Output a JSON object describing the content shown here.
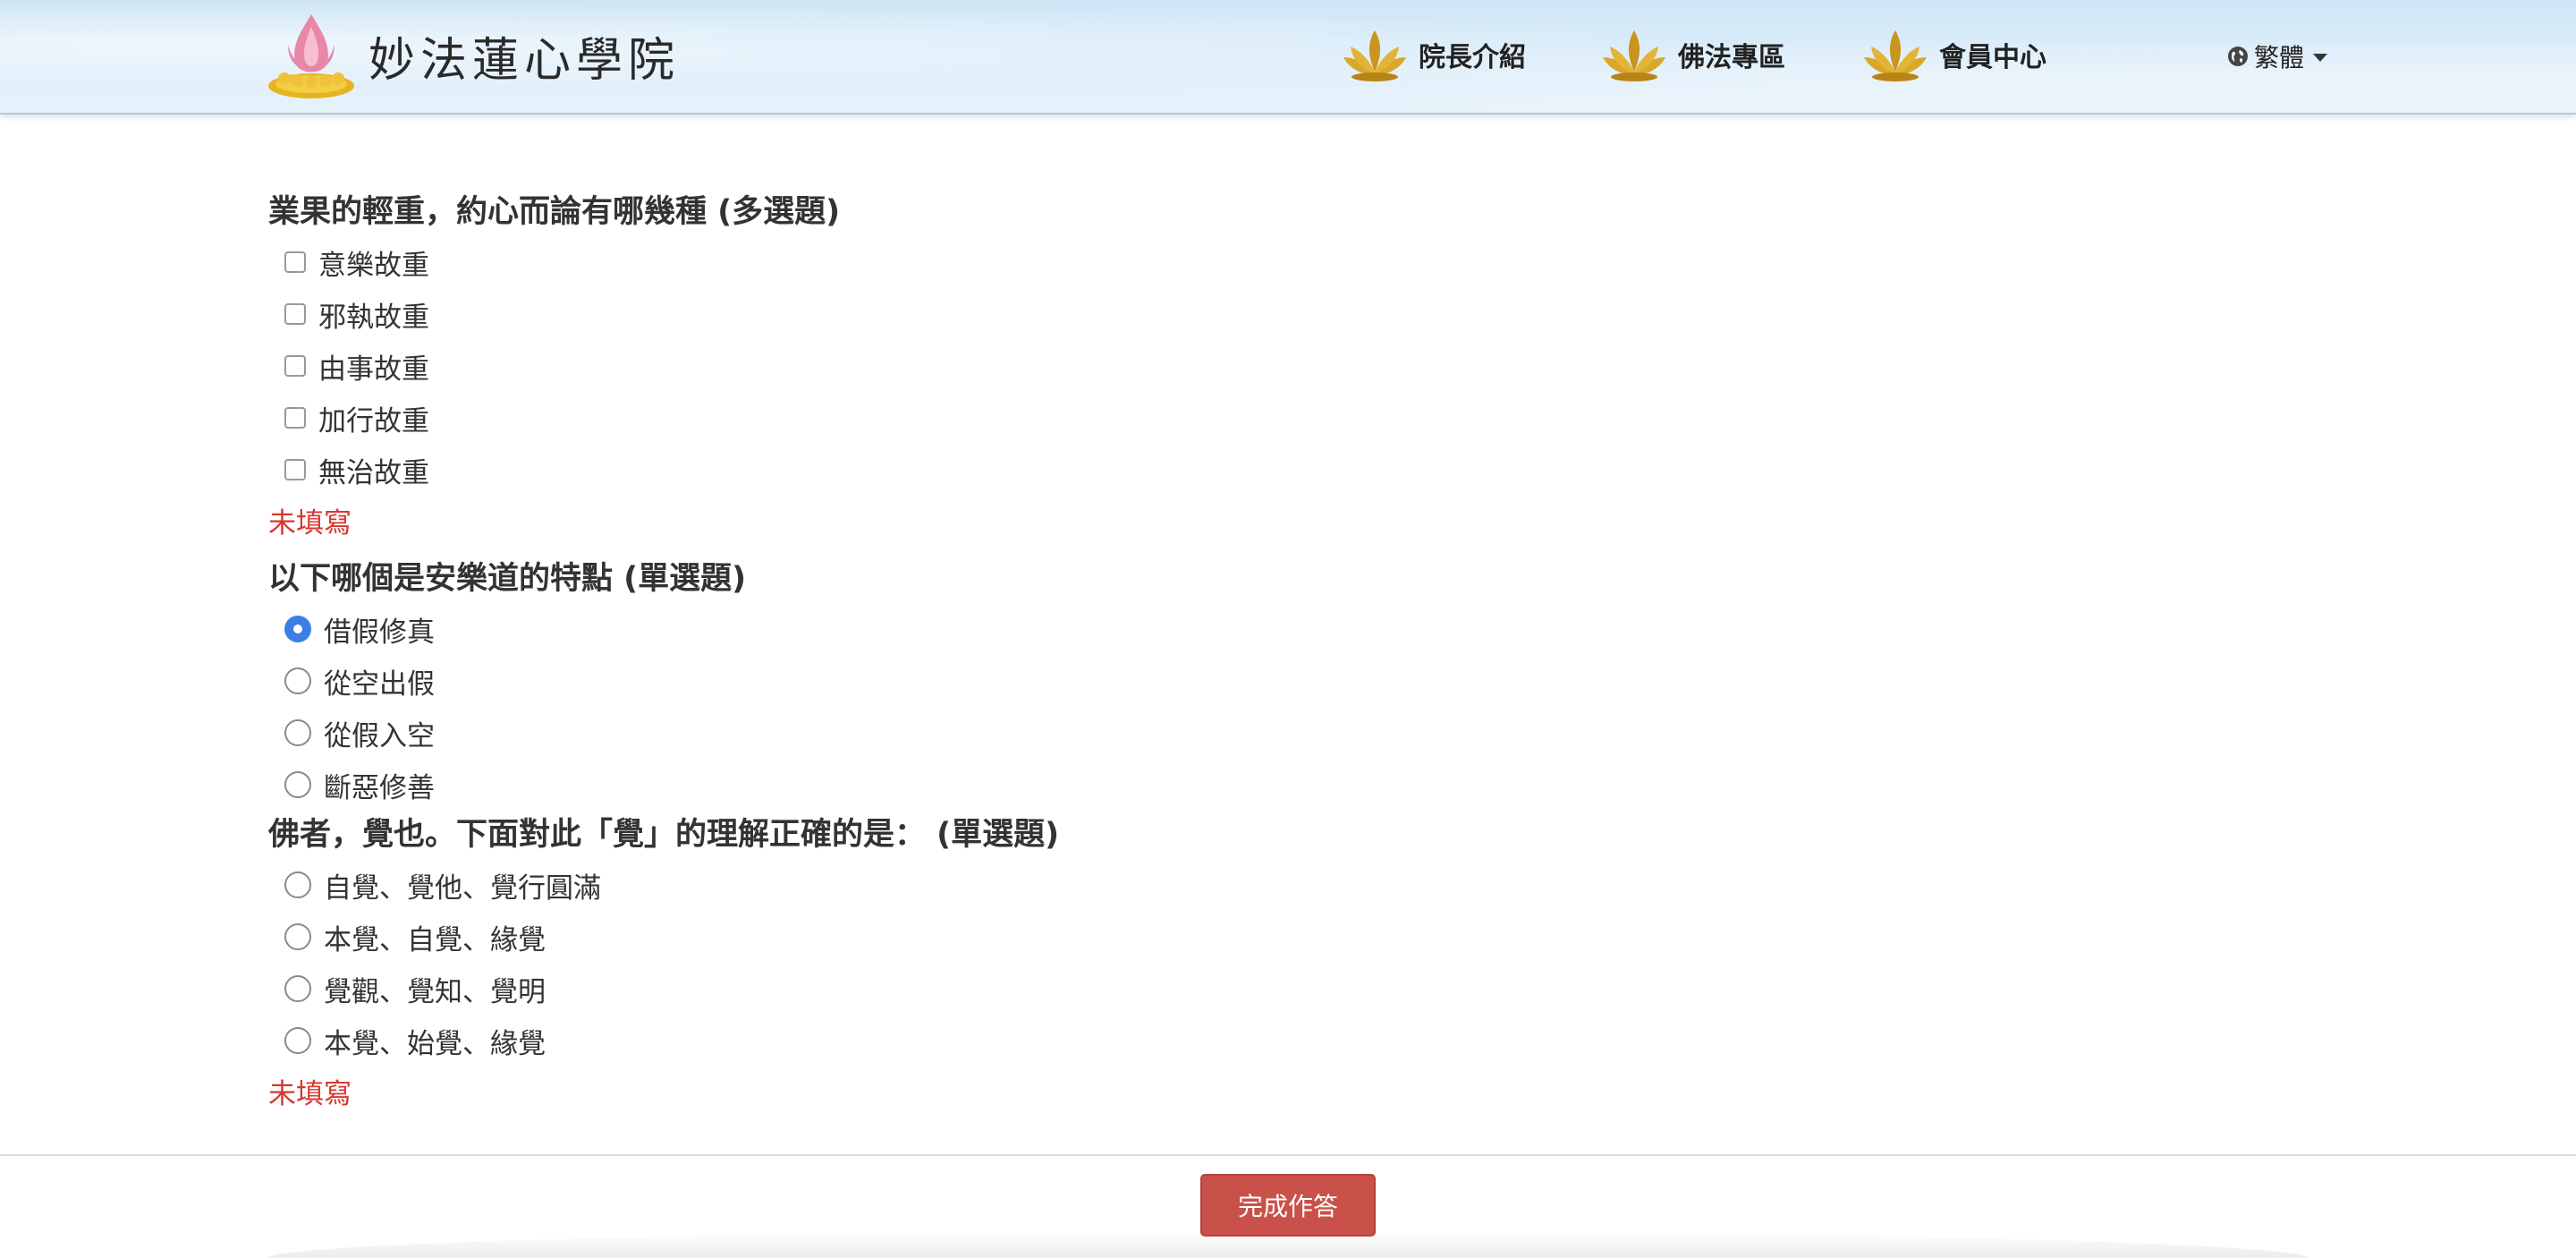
{
  "header": {
    "site_name": "妙法蓮心學院",
    "nav": [
      {
        "label": "院長介紹",
        "icon": "lotus-icon"
      },
      {
        "label": "佛法專區",
        "icon": "lotus-icon"
      },
      {
        "label": "會員中心",
        "icon": "lotus-icon"
      }
    ],
    "language": {
      "label": "繁體",
      "icon": "globe-icon"
    }
  },
  "questions": [
    {
      "title": "業果的輕重，約心而論有哪幾種 (多選題)",
      "type": "checkbox",
      "options": [
        {
          "label": "意樂故重",
          "checked": false
        },
        {
          "label": "邪執故重",
          "checked": false
        },
        {
          "label": "由事故重",
          "checked": false
        },
        {
          "label": "加行故重",
          "checked": false
        },
        {
          "label": "無治故重",
          "checked": false
        }
      ],
      "error": "未填寫"
    },
    {
      "title": "以下哪個是安樂道的特點 (單選題)",
      "type": "radio",
      "options": [
        {
          "label": "借假修真",
          "checked": true
        },
        {
          "label": "從空出假",
          "checked": false
        },
        {
          "label": "從假入空",
          "checked": false
        },
        {
          "label": "斷惡修善",
          "checked": false
        }
      ],
      "error": ""
    },
    {
      "title": "佛者，覺也。下面對此「覺」的理解正確的是： (單選題)",
      "type": "radio",
      "options": [
        {
          "label": "自覺、覺他、覺行圓滿",
          "checked": false
        },
        {
          "label": "本覺、自覺、緣覺",
          "checked": false
        },
        {
          "label": "覺觀、覺知、覺明",
          "checked": false
        },
        {
          "label": "本覺、始覺、緣覺",
          "checked": false
        }
      ],
      "error": "未填寫"
    }
  ],
  "footer": {
    "submit_label": "完成作答"
  },
  "colors": {
    "accent": "#3d7ee6",
    "error": "#d9362f",
    "submit": "#c9514a",
    "header_bg": "#d9ecf8"
  }
}
